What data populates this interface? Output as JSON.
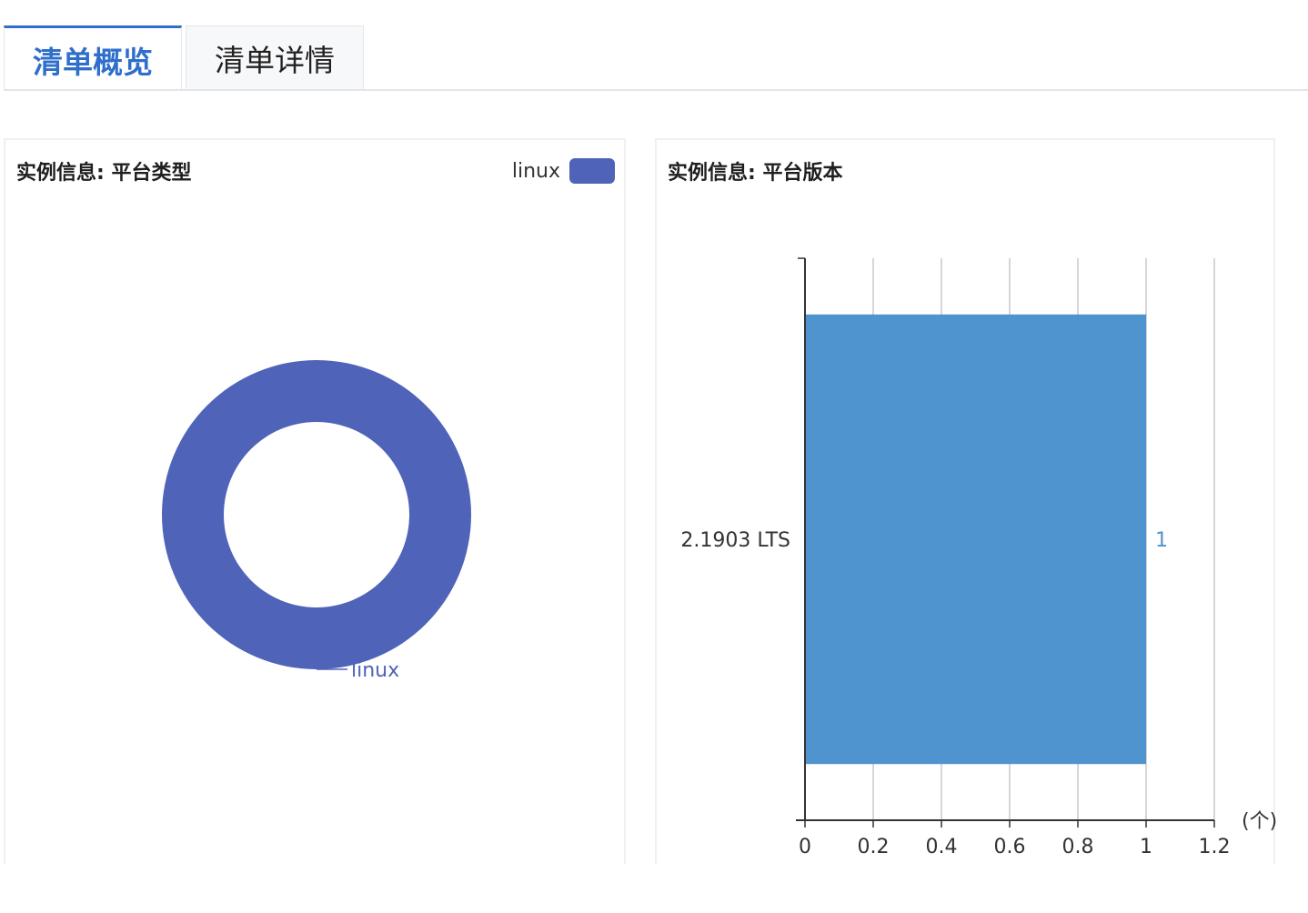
{
  "tabs": [
    {
      "label": "清单概览",
      "active": true
    },
    {
      "label": "清单详情",
      "active": false
    }
  ],
  "colors": {
    "accent": "#2f6fcb",
    "pie": "#4f63b8",
    "bar": "#4f93cf"
  },
  "chart_data": [
    {
      "type": "pie",
      "title": "实例信息: 平台类型",
      "legend": {
        "position": "top-right",
        "items": [
          "linux"
        ]
      },
      "slices": [
        {
          "label": "linux",
          "value": 1
        }
      ],
      "donut": true
    },
    {
      "type": "bar",
      "orientation": "horizontal",
      "title": "实例信息: 平台版本",
      "categories": [
        "2.1903 LTS"
      ],
      "values": [
        1
      ],
      "data_labels": [
        "1"
      ],
      "xlim": [
        0,
        1.2
      ],
      "xticks": [
        "0",
        "0.2",
        "0.4",
        "0.6",
        "0.8",
        "1",
        "1.2"
      ],
      "xunit": "(个)",
      "grid": true
    }
  ]
}
